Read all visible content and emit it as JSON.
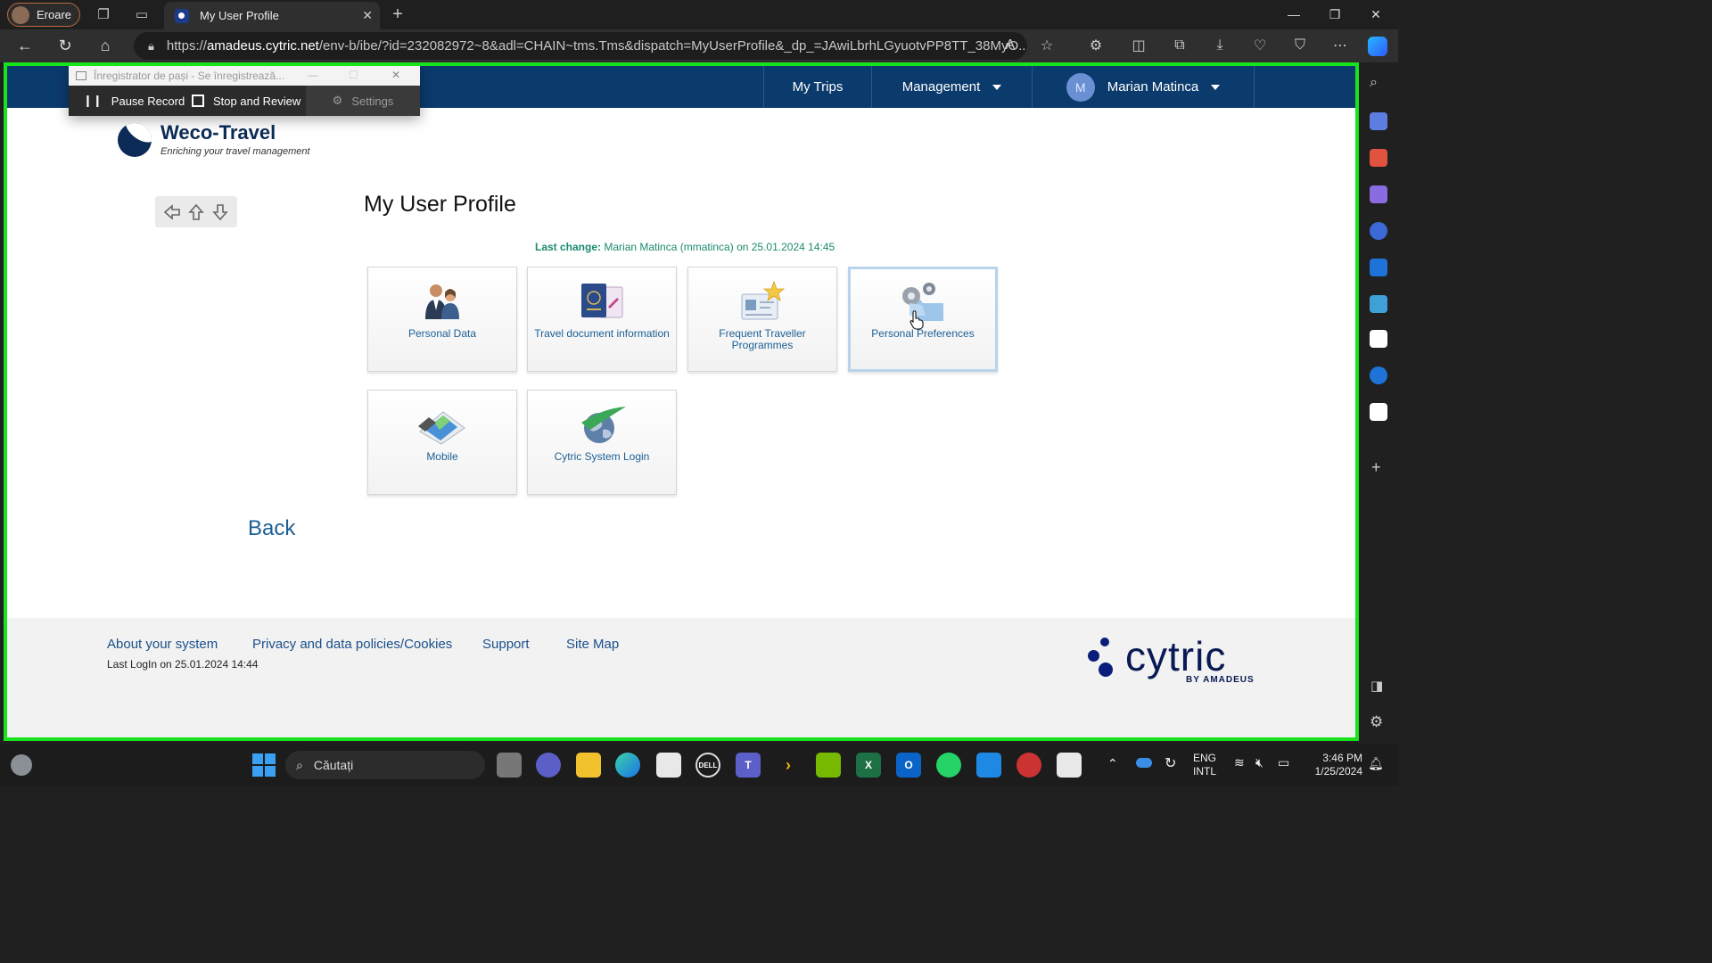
{
  "browser": {
    "profile_label": "Eroare",
    "tab_title": "My User Profile",
    "url_prefix": "https://",
    "url_host": "amadeus.cytric.net",
    "url_path": "/env-b/ibe/?id=232082972~8&adl=CHAIN~tms.Tms&dispatch=MyUserProfile&_dp_=JAwiLbrhLGyuotvPP8TT_38MyO..."
  },
  "recorder": {
    "title": "Înregistrator de pași - Se înregistrează...",
    "pause_label": "Pause Record",
    "stop_label": "Stop and Review",
    "settings_label": "Settings"
  },
  "topnav": {
    "my_trips": "My Trips",
    "management": "Management",
    "user_initial": "M",
    "user_name": "Marian Matinca"
  },
  "logo": {
    "name": "Weco-Travel",
    "tagline": "Enriching your travel management"
  },
  "page": {
    "title": "My User Profile",
    "last_change_label": "Last change:",
    "last_change_value": "Marian Matinca (mmatinca) on 25.01.2024 14:45",
    "back_label": "Back"
  },
  "tiles": [
    {
      "label": "Personal Data",
      "icon": "people-icon"
    },
    {
      "label": "Travel document information",
      "icon": "passport-icon"
    },
    {
      "label": "Frequent Traveller Programmes",
      "icon": "id-card-star-icon"
    },
    {
      "label": "Personal Preferences",
      "icon": "gears-folder-icon",
      "selected": true
    },
    {
      "label": "Mobile",
      "icon": "mobile-phone-icon"
    },
    {
      "label": "Cytric System Login",
      "icon": "globe-icon"
    }
  ],
  "footer": {
    "about": "About your system",
    "privacy": "Privacy and data policies/Cookies",
    "support": "Support",
    "sitemap": "Site Map",
    "last_login": "Last LogIn on 25.01.2024 14:44",
    "brand": "cytric",
    "brand_by": "BY AMADEUS"
  },
  "taskbar": {
    "search_placeholder": "Căutați",
    "lang_line1": "ENG",
    "lang_line2": "INTL",
    "time": "3:46 PM",
    "date": "1/25/2024"
  },
  "colors": {
    "nav_bg": "#0b3a6c",
    "link": "#1a5f95",
    "last_change": "#1c8a6e",
    "highlight_border": "#19e31d"
  }
}
